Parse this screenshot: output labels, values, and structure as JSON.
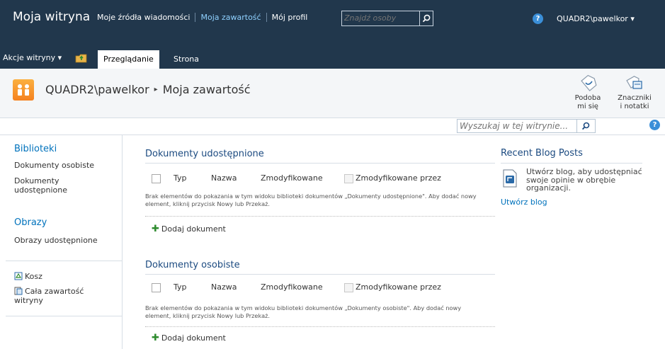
{
  "top": {
    "site_title": "Moja witryna",
    "nav": [
      "Moje źródła wiadomości",
      "Moja zawartość",
      "Mój profil"
    ],
    "people_search_placeholder": "Znajdź osoby",
    "help_symbol": "?",
    "user": "QUADR2\\pawelkor ▾"
  },
  "ribbon": {
    "actions": "Akcje witryny ▾",
    "tabs": [
      "Przeglądanie",
      "Strona"
    ],
    "buttons": [
      {
        "line1": "Podoba",
        "line2": "mi się"
      },
      {
        "line1": "Znaczniki",
        "line2": "i notatki"
      }
    ]
  },
  "breadcrumb": {
    "root": "QUADR2\\pawelkor",
    "separator": "▸",
    "current": "Moja zawartość"
  },
  "site_search_placeholder": "Wyszukaj w tej witrynie...",
  "leftnav": {
    "sections": [
      {
        "heading": "Biblioteki",
        "items": [
          "Dokumenty osobiste",
          "Dokumenty udostępnione"
        ]
      },
      {
        "heading": "Obrazy",
        "items": [
          "Obrazy udostępnione"
        ]
      }
    ],
    "bottom": [
      "Kosz",
      "Cała zawartość witryny"
    ]
  },
  "webparts": [
    {
      "title": "Dokumenty udostępnione",
      "columns": [
        "Typ",
        "Nazwa",
        "Zmodyfikowane",
        "Zmodyfikowane przez"
      ],
      "empty": "Brak elementów do pokazania w tym widoku biblioteki dokumentów „Dokumenty udostępnione\". Aby dodać nowy element, kliknij przycisk Nowy lub Przekaż.",
      "add": "Dodaj dokument"
    },
    {
      "title": "Dokumenty osobiste",
      "columns": [
        "Typ",
        "Nazwa",
        "Zmodyfikowane",
        "Zmodyfikowane przez"
      ],
      "empty": "Brak elementów do pokazania w tym widoku biblioteki dokumentów „Dokumenty osobiste\". Aby dodać nowy element, kliknij przycisk Nowy lub Przekaż.",
      "add": "Dodaj dokument"
    }
  ],
  "blog": {
    "title": "Recent Blog Posts",
    "text": "Utwórz blog, aby udostępniać swoje opinie w obrębie organizacji.",
    "link": "Utwórz blog"
  },
  "colors": {
    "topbar": "#21374c",
    "link": "#0072bc",
    "heading": "#1b4a80"
  }
}
